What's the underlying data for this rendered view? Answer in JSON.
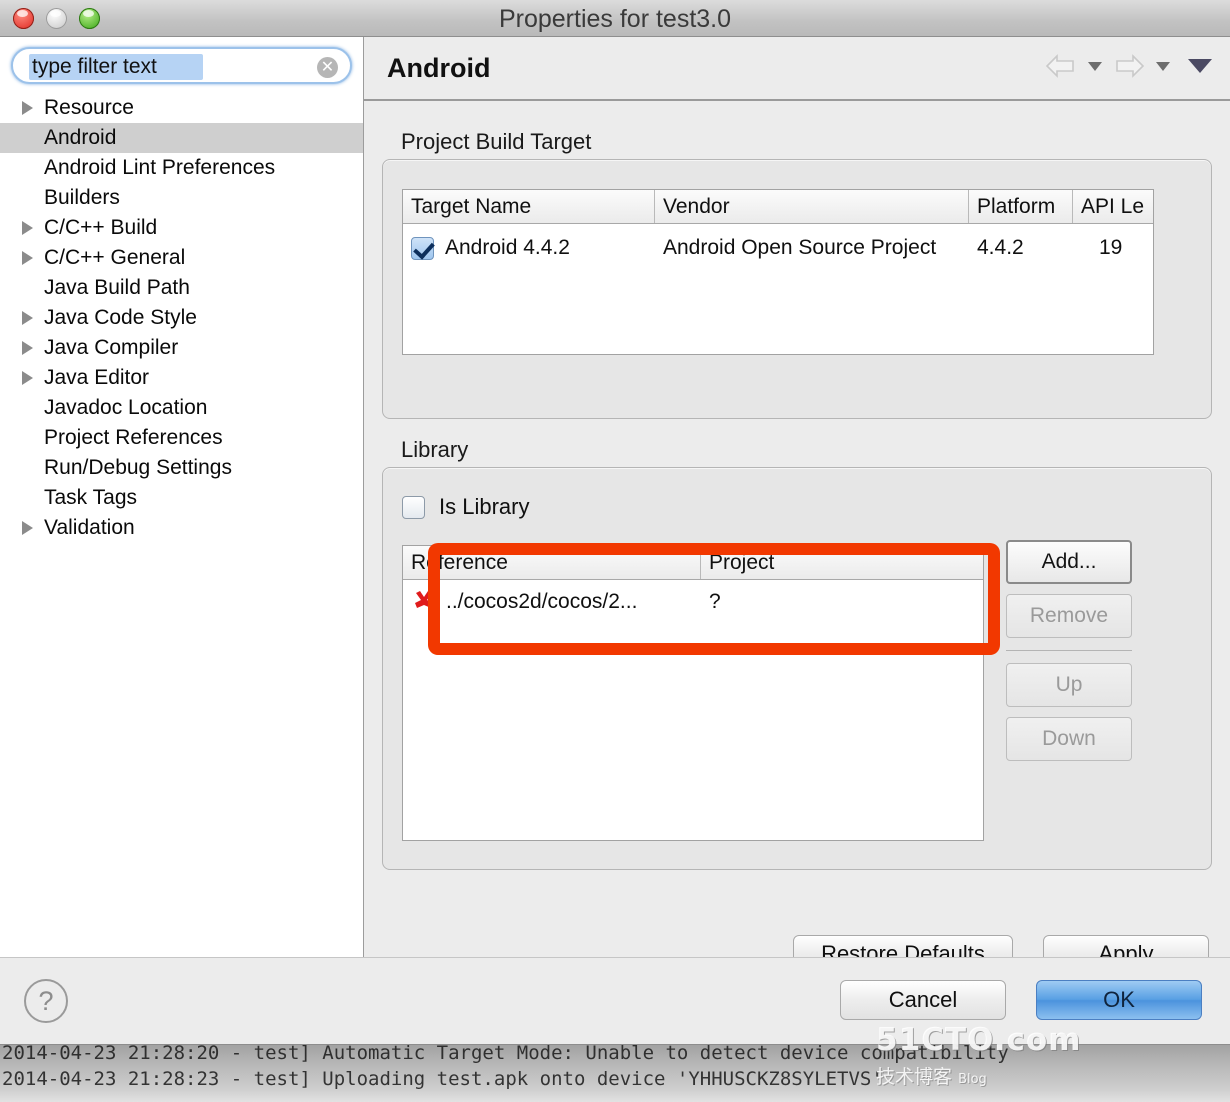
{
  "window": {
    "title": "Properties for test3.0",
    "traffic_lights": [
      "close-button",
      "minimize-button",
      "zoom-button"
    ]
  },
  "sidebar": {
    "filter": {
      "value": "type filter text",
      "placeholder": "type filter text",
      "clear_icon": "clear-icon"
    },
    "items": [
      {
        "label": "Resource",
        "expandable": true,
        "selected": false
      },
      {
        "label": "Android",
        "expandable": false,
        "selected": true
      },
      {
        "label": "Android Lint Preferences",
        "expandable": false,
        "selected": false
      },
      {
        "label": "Builders",
        "expandable": false,
        "selected": false
      },
      {
        "label": "C/C++ Build",
        "expandable": true,
        "selected": false
      },
      {
        "label": "C/C++ General",
        "expandable": true,
        "selected": false
      },
      {
        "label": "Java Build Path",
        "expandable": false,
        "selected": false
      },
      {
        "label": "Java Code Style",
        "expandable": true,
        "selected": false
      },
      {
        "label": "Java Compiler",
        "expandable": true,
        "selected": false
      },
      {
        "label": "Java Editor",
        "expandable": true,
        "selected": false
      },
      {
        "label": "Javadoc Location",
        "expandable": false,
        "selected": false
      },
      {
        "label": "Project References",
        "expandable": false,
        "selected": false
      },
      {
        "label": "Run/Debug Settings",
        "expandable": false,
        "selected": false
      },
      {
        "label": "Task Tags",
        "expandable": false,
        "selected": false
      },
      {
        "label": "Validation",
        "expandable": true,
        "selected": false
      }
    ]
  },
  "page": {
    "title": "Android",
    "nav": {
      "back_icon": "back-arrow-icon",
      "forward_icon": "forward-arrow-icon",
      "menu_icon": "view-menu-icon"
    }
  },
  "build_target": {
    "group_title": "Project Build Target",
    "columns": [
      "Target Name",
      "Vendor",
      "Platform",
      "API Le"
    ],
    "rows": [
      {
        "checked": true,
        "target_name": "Android 4.4.2",
        "vendor": "Android Open Source Project",
        "platform": "4.4.2",
        "api_level": "19"
      }
    ]
  },
  "library": {
    "group_title": "Library",
    "is_library_label": "Is Library",
    "is_library_checked": false,
    "columns": [
      "Reference",
      "Project"
    ],
    "rows": [
      {
        "status_icon": "error-x-icon",
        "reference": "../cocos2d/cocos/2...",
        "project": "?"
      }
    ],
    "buttons": [
      {
        "label": "Add...",
        "enabled": true
      },
      {
        "label": "Remove",
        "enabled": false
      },
      {
        "label": "Up",
        "enabled": false
      },
      {
        "label": "Down",
        "enabled": false
      }
    ]
  },
  "actions": {
    "restore_defaults": "Restore Defaults",
    "apply": "Apply",
    "cancel": "Cancel",
    "ok": "OK",
    "help_icon": "help-icon",
    "help_glyph": "?"
  },
  "console": {
    "lines": [
      "2014-04-23 21:28:20 - test] Automatic Target Mode: Unable to detect device compatibility",
      "2014-04-23 21:28:23 - test] Uploading test.apk onto device 'YHHUSCKZ8SYLETVS'"
    ]
  },
  "watermark": {
    "main": "51CTO.com",
    "sub_cn": "技术博客",
    "sub_en": "Blog"
  },
  "colors": {
    "accent": "#4c93dd",
    "annotation": "#f23800",
    "selection": "#cfcfcf",
    "error": "#e01b1b"
  }
}
